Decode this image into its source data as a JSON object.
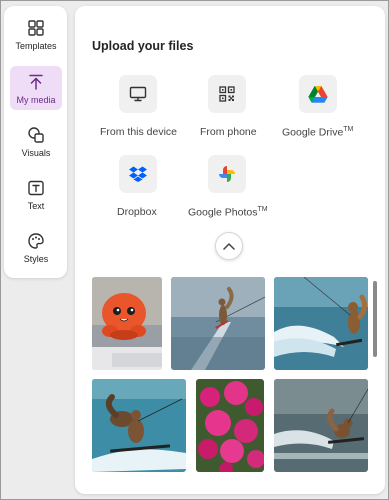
{
  "rail": {
    "items": [
      {
        "label": "Templates",
        "icon": "templates-icon"
      },
      {
        "label": "My media",
        "icon": "upload-icon"
      },
      {
        "label": "Visuals",
        "icon": "visuals-icon"
      },
      {
        "label": "Text",
        "icon": "text-icon"
      },
      {
        "label": "Styles",
        "icon": "styles-icon"
      }
    ],
    "active": "My media",
    "accent_color": "#6b2d86",
    "active_bg": "#efdcf7"
  },
  "upload": {
    "title": "Upload your files",
    "sources": [
      {
        "label": "From this device",
        "icon": "monitor-icon"
      },
      {
        "label": "From phone",
        "icon": "qr-code-icon"
      },
      {
        "label": "Google Drive",
        "tm": "TM",
        "icon": "google-drive-icon"
      },
      {
        "label": "Dropbox",
        "icon": "dropbox-icon"
      },
      {
        "label": "Google Photos",
        "tm": "TM",
        "icon": "google-photos-icon"
      }
    ],
    "collapse_icon": "chevron-up-icon"
  },
  "media": {
    "thumbnails": [
      {
        "subject": "orange plush toy"
      },
      {
        "subject": "squirrel water skiing"
      },
      {
        "subject": "squirrel water skiing with splash"
      },
      {
        "subject": "squirrel water skiing"
      },
      {
        "subject": "pink bougainvillea flowers"
      },
      {
        "subject": "squirrel water skiing"
      }
    ]
  }
}
